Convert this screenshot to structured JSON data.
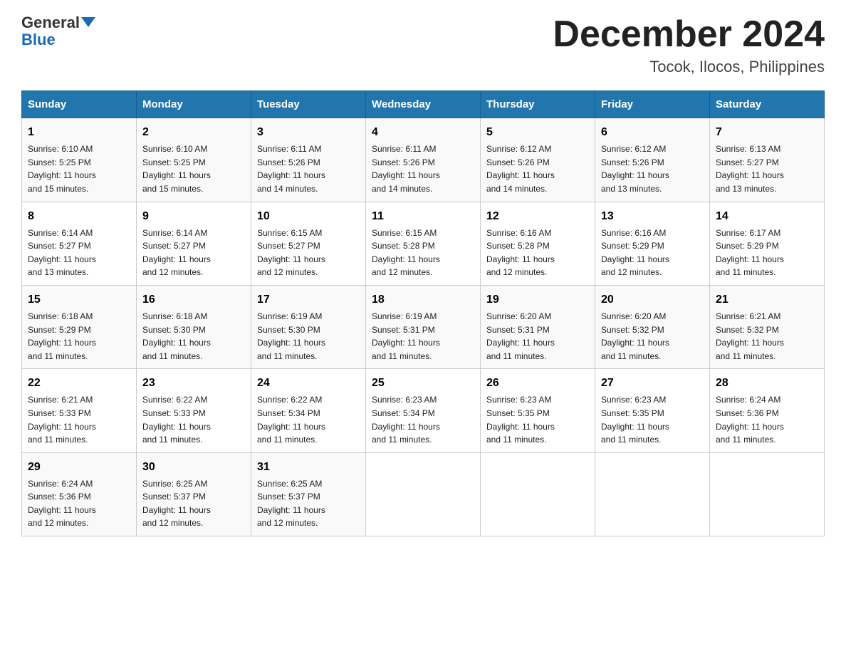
{
  "header": {
    "logo_general": "General",
    "logo_blue": "Blue",
    "month_title": "December 2024",
    "location": "Tocok, Ilocos, Philippines"
  },
  "days_of_week": [
    "Sunday",
    "Monday",
    "Tuesday",
    "Wednesday",
    "Thursday",
    "Friday",
    "Saturday"
  ],
  "weeks": [
    [
      {
        "day": "1",
        "info": "Sunrise: 6:10 AM\nSunset: 5:25 PM\nDaylight: 11 hours\nand 15 minutes."
      },
      {
        "day": "2",
        "info": "Sunrise: 6:10 AM\nSunset: 5:25 PM\nDaylight: 11 hours\nand 15 minutes."
      },
      {
        "day": "3",
        "info": "Sunrise: 6:11 AM\nSunset: 5:26 PM\nDaylight: 11 hours\nand 14 minutes."
      },
      {
        "day": "4",
        "info": "Sunrise: 6:11 AM\nSunset: 5:26 PM\nDaylight: 11 hours\nand 14 minutes."
      },
      {
        "day": "5",
        "info": "Sunrise: 6:12 AM\nSunset: 5:26 PM\nDaylight: 11 hours\nand 14 minutes."
      },
      {
        "day": "6",
        "info": "Sunrise: 6:12 AM\nSunset: 5:26 PM\nDaylight: 11 hours\nand 13 minutes."
      },
      {
        "day": "7",
        "info": "Sunrise: 6:13 AM\nSunset: 5:27 PM\nDaylight: 11 hours\nand 13 minutes."
      }
    ],
    [
      {
        "day": "8",
        "info": "Sunrise: 6:14 AM\nSunset: 5:27 PM\nDaylight: 11 hours\nand 13 minutes."
      },
      {
        "day": "9",
        "info": "Sunrise: 6:14 AM\nSunset: 5:27 PM\nDaylight: 11 hours\nand 12 minutes."
      },
      {
        "day": "10",
        "info": "Sunrise: 6:15 AM\nSunset: 5:27 PM\nDaylight: 11 hours\nand 12 minutes."
      },
      {
        "day": "11",
        "info": "Sunrise: 6:15 AM\nSunset: 5:28 PM\nDaylight: 11 hours\nand 12 minutes."
      },
      {
        "day": "12",
        "info": "Sunrise: 6:16 AM\nSunset: 5:28 PM\nDaylight: 11 hours\nand 12 minutes."
      },
      {
        "day": "13",
        "info": "Sunrise: 6:16 AM\nSunset: 5:29 PM\nDaylight: 11 hours\nand 12 minutes."
      },
      {
        "day": "14",
        "info": "Sunrise: 6:17 AM\nSunset: 5:29 PM\nDaylight: 11 hours\nand 11 minutes."
      }
    ],
    [
      {
        "day": "15",
        "info": "Sunrise: 6:18 AM\nSunset: 5:29 PM\nDaylight: 11 hours\nand 11 minutes."
      },
      {
        "day": "16",
        "info": "Sunrise: 6:18 AM\nSunset: 5:30 PM\nDaylight: 11 hours\nand 11 minutes."
      },
      {
        "day": "17",
        "info": "Sunrise: 6:19 AM\nSunset: 5:30 PM\nDaylight: 11 hours\nand 11 minutes."
      },
      {
        "day": "18",
        "info": "Sunrise: 6:19 AM\nSunset: 5:31 PM\nDaylight: 11 hours\nand 11 minutes."
      },
      {
        "day": "19",
        "info": "Sunrise: 6:20 AM\nSunset: 5:31 PM\nDaylight: 11 hours\nand 11 minutes."
      },
      {
        "day": "20",
        "info": "Sunrise: 6:20 AM\nSunset: 5:32 PM\nDaylight: 11 hours\nand 11 minutes."
      },
      {
        "day": "21",
        "info": "Sunrise: 6:21 AM\nSunset: 5:32 PM\nDaylight: 11 hours\nand 11 minutes."
      }
    ],
    [
      {
        "day": "22",
        "info": "Sunrise: 6:21 AM\nSunset: 5:33 PM\nDaylight: 11 hours\nand 11 minutes."
      },
      {
        "day": "23",
        "info": "Sunrise: 6:22 AM\nSunset: 5:33 PM\nDaylight: 11 hours\nand 11 minutes."
      },
      {
        "day": "24",
        "info": "Sunrise: 6:22 AM\nSunset: 5:34 PM\nDaylight: 11 hours\nand 11 minutes."
      },
      {
        "day": "25",
        "info": "Sunrise: 6:23 AM\nSunset: 5:34 PM\nDaylight: 11 hours\nand 11 minutes."
      },
      {
        "day": "26",
        "info": "Sunrise: 6:23 AM\nSunset: 5:35 PM\nDaylight: 11 hours\nand 11 minutes."
      },
      {
        "day": "27",
        "info": "Sunrise: 6:23 AM\nSunset: 5:35 PM\nDaylight: 11 hours\nand 11 minutes."
      },
      {
        "day": "28",
        "info": "Sunrise: 6:24 AM\nSunset: 5:36 PM\nDaylight: 11 hours\nand 11 minutes."
      }
    ],
    [
      {
        "day": "29",
        "info": "Sunrise: 6:24 AM\nSunset: 5:36 PM\nDaylight: 11 hours\nand 12 minutes."
      },
      {
        "day": "30",
        "info": "Sunrise: 6:25 AM\nSunset: 5:37 PM\nDaylight: 11 hours\nand 12 minutes."
      },
      {
        "day": "31",
        "info": "Sunrise: 6:25 AM\nSunset: 5:37 PM\nDaylight: 11 hours\nand 12 minutes."
      },
      {
        "day": "",
        "info": ""
      },
      {
        "day": "",
        "info": ""
      },
      {
        "day": "",
        "info": ""
      },
      {
        "day": "",
        "info": ""
      }
    ]
  ]
}
